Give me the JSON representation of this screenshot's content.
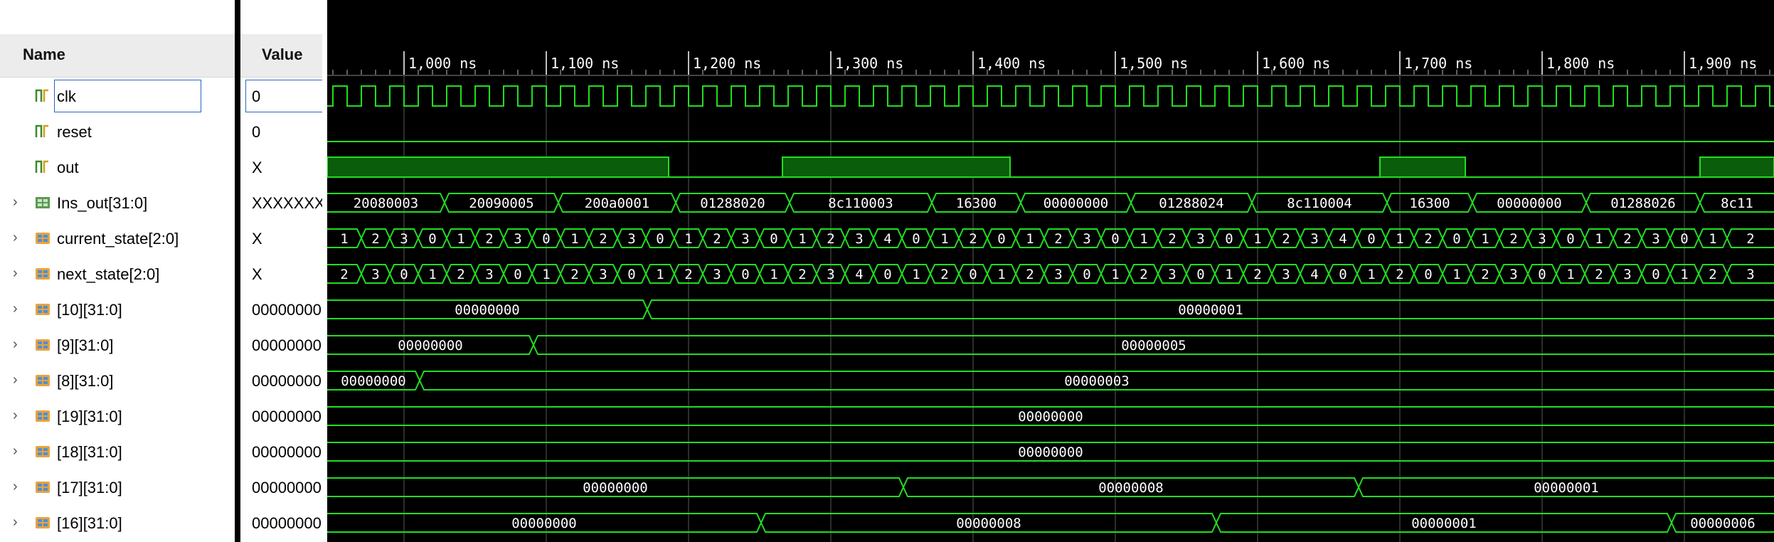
{
  "headers": {
    "name": "Name",
    "value": "Value"
  },
  "timeline": {
    "ticks": [
      "1,000 ns",
      "1,100 ns",
      "1,200 ns",
      "1,300 ns",
      "1,400 ns",
      "1,500 ns",
      "1,600 ns",
      "1,700 ns",
      "1,800 ns",
      "1,900 ns"
    ]
  },
  "signals": [
    {
      "name": "clk",
      "value": "0",
      "icon": "bit-signal-icon",
      "expandable": false,
      "selected": true
    },
    {
      "name": "reset",
      "value": "0",
      "icon": "bit-signal-icon",
      "expandable": false
    },
    {
      "name": "out",
      "value": "X",
      "icon": "output-bit-icon",
      "expandable": false
    },
    {
      "name": "Ins_out[31:0]",
      "value": "XXXXXXXX",
      "icon": "bus-output-icon",
      "expandable": true
    },
    {
      "name": "current_state[2:0]",
      "value": "X",
      "icon": "bus-signal-icon",
      "expandable": true
    },
    {
      "name": "next_state[2:0]",
      "value": "X",
      "icon": "bus-signal-icon",
      "expandable": true
    },
    {
      "name": "[10][31:0]",
      "value": "00000000",
      "icon": "bus-signal-icon",
      "expandable": true
    },
    {
      "name": "[9][31:0]",
      "value": "00000000",
      "icon": "bus-signal-icon",
      "expandable": true
    },
    {
      "name": "[8][31:0]",
      "value": "00000000",
      "icon": "bus-signal-icon",
      "expandable": true
    },
    {
      "name": "[19][31:0]",
      "value": "00000000",
      "icon": "bus-signal-icon",
      "expandable": true
    },
    {
      "name": "[18][31:0]",
      "value": "00000000",
      "icon": "bus-signal-icon",
      "expandable": true
    },
    {
      "name": "[17][31:0]",
      "value": "00000000",
      "icon": "bus-signal-icon",
      "expandable": true
    },
    {
      "name": "[16][31:0]",
      "value": "00000000",
      "icon": "bus-signal-icon",
      "expandable": true
    }
  ],
  "waves": {
    "ins_out": [
      "20080003",
      "20090005",
      "200a0001",
      "01288020",
      "8c110003",
      "16300",
      "00000000",
      "01288024",
      "8c110004",
      "16300",
      "00000000",
      "01288026",
      "8c11"
    ],
    "current_state": [
      "1",
      "2",
      "3",
      "0",
      "1",
      "2",
      "3",
      "0",
      "1",
      "2",
      "3",
      "0",
      "1",
      "2",
      "3",
      "0",
      "1",
      "2",
      "3",
      "4",
      "0",
      "1",
      "2",
      "0",
      "1",
      "2",
      "3",
      "0",
      "1",
      "2",
      "3",
      "0",
      "1",
      "2",
      "3",
      "4",
      "0",
      "1",
      "2",
      "0",
      "1",
      "2",
      "3",
      "0",
      "1",
      "2",
      "3",
      "0",
      "1",
      "2"
    ],
    "next_state": [
      "2",
      "3",
      "0",
      "1",
      "2",
      "3",
      "0",
      "1",
      "2",
      "3",
      "0",
      "1",
      "2",
      "3",
      "0",
      "1",
      "2",
      "3",
      "4",
      "0",
      "1",
      "2",
      "0",
      "1",
      "2",
      "3",
      "0",
      "1",
      "2",
      "3",
      "0",
      "1",
      "2",
      "3",
      "4",
      "0",
      "1",
      "2",
      "0",
      "1",
      "2",
      "3",
      "0",
      "1",
      "2",
      "3",
      "0",
      "1",
      "2",
      "3"
    ],
    "reg10": [
      "00000000",
      "00000001"
    ],
    "reg9": [
      "00000000",
      "00000005"
    ],
    "reg8": [
      "00000000",
      "00000003"
    ],
    "reg19": [
      "00000000"
    ],
    "reg18": [
      "00000000"
    ],
    "reg17": [
      "00000000",
      "00000008",
      "00000001"
    ],
    "reg16": [
      "00000000",
      "00000008",
      "00000001",
      "00000006"
    ]
  },
  "colors": {
    "wave": "#22dd22",
    "wave_fill": "#0a5d0a",
    "grid": "#5a5a5a",
    "cursor": "#cfcfcf",
    "selection": "#2c66b8"
  }
}
